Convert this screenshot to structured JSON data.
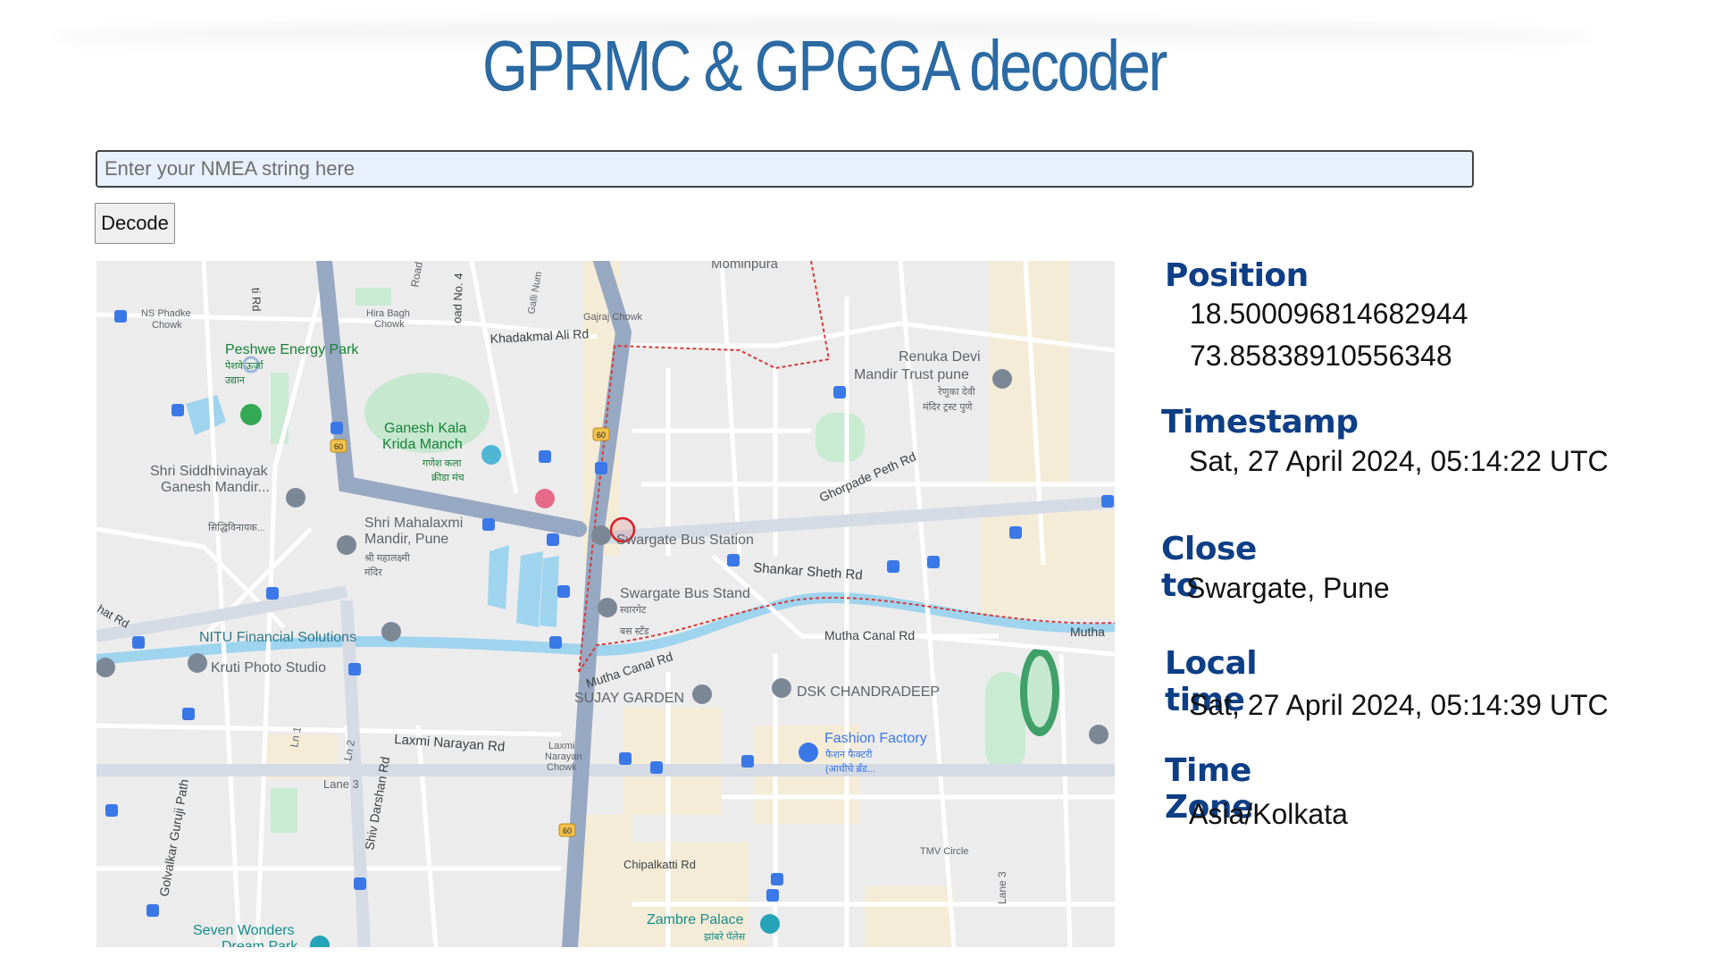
{
  "page": {
    "title": "GPRMC & GPGGA decoder"
  },
  "input": {
    "placeholder": "Enter your NMEA string here",
    "value": ""
  },
  "decode_button": {
    "label": "Decode"
  },
  "info": {
    "position": {
      "heading": "Position",
      "latitude": "18.500096814682944",
      "longitude": "73.85838910556348"
    },
    "timestamp": {
      "heading": "Timestamp",
      "value": "Sat, 27 April 2024, 05:14:22 UTC"
    },
    "close_to": {
      "heading": "Close to",
      "value": "Swargate, Pune"
    },
    "local_time": {
      "heading": "Local time",
      "value": "Sat, 27 April 2024, 05:14:39 UTC"
    },
    "time_zone": {
      "heading": "Time Zone",
      "value": "Asia/Kolkata"
    }
  },
  "map": {
    "labels": {
      "momin": "Mominpura",
      "ns_phadke": "NS Phadke",
      "chowk": "Chowk",
      "hira_bagh": "Hira Bagh",
      "hira_chowk": "Chowk",
      "gajraj": "Gajraj Chowk",
      "khadakmal": "Khadakmal Ali Rd",
      "peshwe": "Peshwe Energy Park",
      "peshwe_mr1": "पेशवे ऊर्जा",
      "peshwe_mr2": "उद्यान",
      "ganesh_kala1": "Ganesh Kala",
      "ganesh_kala2": "Krida Manch",
      "ganesh_mr1": "गणेश कला",
      "ganesh_mr2": "क्रीडा मंच",
      "renuka1": "Renuka Devi",
      "renuka2": "Mandir Trust pune",
      "renuka_mr1": "रेणुका देवी",
      "renuka_mr2": "मंदिर ट्रस्ट पुणे",
      "siddhi1": "Shri Siddhivinayak",
      "siddhi2": "Ganesh Mandir...",
      "siddhi_mr": "सिद्धिविनायक...",
      "ghorpade": "Ghorpade Peth Rd",
      "mahalaxmi1": "Shri Mahalaxmi",
      "mahalaxmi2": "Mandir, Pune",
      "mahalaxmi_mr1": "श्री महालक्ष्मी",
      "mahalaxmi_mr2": "मंदिर",
      "swargate_bs": "Swargate Bus Station",
      "shankar": "Shankar Sheth Rd",
      "bus_stand": "Swargate Bus Stand",
      "bus_stand_mr1": "स्वारगेट",
      "bus_stand_mr2": "बस स्टँड",
      "mutha_canal": "Mutha Canal Rd",
      "mutha_canal2": "Mutha Canal Rd",
      "mutha_edge": "Mutha",
      "nitu": "NITU Financial Solutions",
      "kruti": "Kruti Photo Studio",
      "sujay": "SUJAY GARDEN",
      "dsk": "DSK CHANDRADEEP",
      "fashion": "Fashion Factory",
      "fashion_mr1": "फैशन फैक्टरी",
      "fashion_mr2": "(आधीचे ब्रँड...",
      "laxmi_rd": "Laxmi Narayan Rd",
      "laxmi_ch1": "Laxmi",
      "laxmi_ch2": "Narayan",
      "laxmi_ch3": "Chowk",
      "lane1": "Ln 1",
      "lane2": "Ln 2",
      "lane3": "Lane 3",
      "lane3b": "Lane 3",
      "shiv": "Shiv Darshan Rd",
      "golvalkar": "Golvalkar Guruji Path",
      "chipalkatti": "Chipalkatti Rd",
      "tmv": "TMV Circle",
      "zambre": "Zambre Palace",
      "zambre_mr": "झांबरे पॅलेस",
      "seven": "Seven Wonders",
      "seven2": "Dream Park",
      "road_cut": "Road",
      "road4": "oad No. 4",
      "galli": "Galli Num",
      "shat": "hat Rd",
      "ti_rd": "ti Rd",
      "hwy": "60"
    }
  }
}
